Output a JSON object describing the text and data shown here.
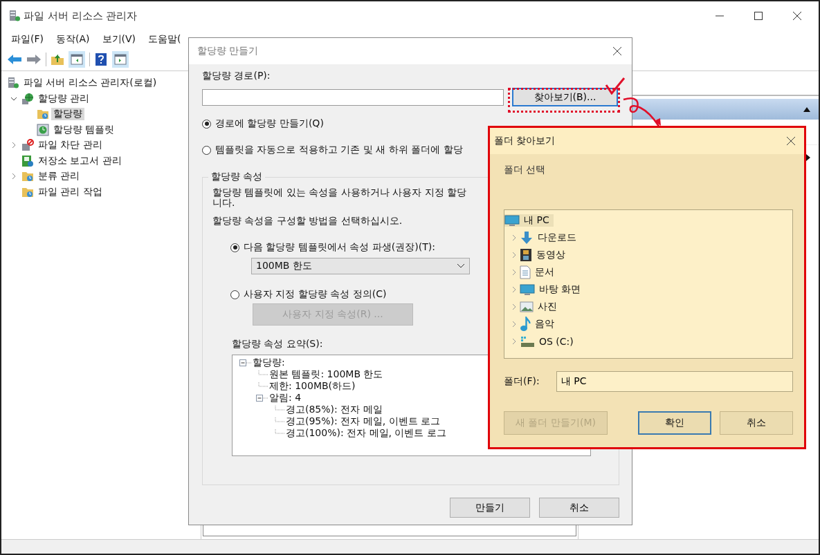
{
  "window": {
    "title": "파일 서버 리소스 관리자"
  },
  "menu": [
    {
      "label": "파일(F)"
    },
    {
      "label": "동작(A)"
    },
    {
      "label": "보기(V)"
    },
    {
      "label": "도움말("
    }
  ],
  "tree": [
    {
      "label": "파일 서버 리소스 관리자(로컬)",
      "selected": false,
      "children": [
        {
          "label": "할당량 관리",
          "selected": false,
          "expanded": true,
          "children": [
            {
              "label": "할당량",
              "selected": true
            },
            {
              "label": "할당량 템플릿",
              "selected": false
            }
          ]
        },
        {
          "label": "파일 차단 관리",
          "selected": false,
          "expanded": false
        },
        {
          "label": "저장소 보고서 관리",
          "selected": false
        },
        {
          "label": "분류 관리",
          "selected": false,
          "expanded": false
        },
        {
          "label": "파일 관리 작업",
          "selected": false
        }
      ]
    }
  ],
  "quota_dialog": {
    "title": "할당량 만들기",
    "path_label": "할당량 경로(P):",
    "browse_button": "찾아보기(B)...",
    "options": [
      {
        "label": "경로에 할당량 만들기(Q)",
        "selected": true
      },
      {
        "label": "템플릿을 자동으로 적용하고 기존 및 새 하위 폴더에 할당",
        "selected": false
      }
    ],
    "properties": {
      "legend": "할당량 속성",
      "description_lines": [
        "할당량 템플릿에 있는 속성을 사용하거나 사용자 지정 할당",
        "니다."
      ],
      "prompt": "할당량 속성을 구성할 방법을 선택하십시오.",
      "sources": [
        {
          "label": "다음 할당량 템플릿에서 속성 파생(권장)(T):",
          "selected": true
        },
        {
          "label": "사용자 지정 할당량 속성 정의(C)",
          "selected": false
        }
      ],
      "template_select": {
        "value": "100MB 한도"
      },
      "custom_button": {
        "label": "사용자 지정 속성(R) ...",
        "disabled": true
      },
      "summary_label": "할당량 속성 요약(S):",
      "summary": [
        {
          "label": "할당량:",
          "expanded": true,
          "children": [
            {
              "label": "원본 템플릿: 100MB 한도"
            },
            {
              "label": "제한: 100MB(하드)"
            },
            {
              "label": "알림: 4",
              "expanded": true,
              "children": [
                {
                  "label": "경고(85%): 전자 메일"
                },
                {
                  "label": "경고(95%): 전자 메일, 이벤트 로그"
                },
                {
                  "label": "경고(100%): 전자 메일, 이벤트 로그"
                }
              ]
            }
          ]
        }
      ]
    },
    "buttons": [
      "만들기",
      "취소"
    ]
  },
  "folder_dialog": {
    "title": "폴더 찾아보기",
    "instruction": "폴더 선택",
    "tree": [
      {
        "label": "내 PC",
        "selected": true,
        "children": [
          {
            "label": "다운로드",
            "selected": false,
            "expanded": false
          },
          {
            "label": "동영상",
            "selected": false,
            "expanded": false
          },
          {
            "label": "문서",
            "selected": false,
            "expanded": false
          },
          {
            "label": "바탕 화면",
            "selected": false,
            "expanded": false
          },
          {
            "label": "사진",
            "selected": false,
            "expanded": false
          },
          {
            "label": "음악",
            "selected": false,
            "expanded": false
          },
          {
            "label": "OS (C:)",
            "selected": false,
            "expanded": false
          }
        ]
      }
    ],
    "folder_label": "폴더(F):",
    "folder_value": "내 PC",
    "new_folder_button": {
      "label": "새 폴더 만들기(M)",
      "disabled": true
    },
    "buttons": [
      {
        "label": "확인",
        "default": true
      },
      {
        "label": "취소",
        "default": false
      }
    ]
  }
}
